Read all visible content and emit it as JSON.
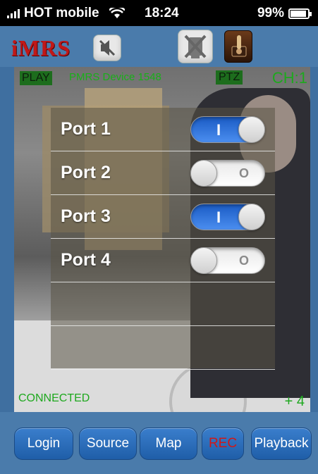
{
  "status_bar": {
    "carrier": "HOT mobile",
    "time": "18:24",
    "battery": "99%"
  },
  "header": {
    "logo": "iMRS",
    "mute_icon": "speaker-muted-icon",
    "camera_icon": "camera-off-icon",
    "switch_icon": "toggle-switch-icon"
  },
  "video": {
    "play_label": "PLAY",
    "device_label": "PMRS Device 1548",
    "ptz_label": "PTZ",
    "channel_label": "CH:1",
    "connection_status": "CONNECTED",
    "zoom_label": "+ 4"
  },
  "ports": [
    {
      "label": "Port 1",
      "state": "on",
      "mark": "I"
    },
    {
      "label": "Port 2",
      "state": "off",
      "mark": "O"
    },
    {
      "label": "Port 3",
      "state": "on",
      "mark": "I"
    },
    {
      "label": "Port 4",
      "state": "off",
      "mark": "O"
    }
  ],
  "toolbar": {
    "login": "Login",
    "source": "Source",
    "map": "Map",
    "rec": "REC",
    "playback": "Playback"
  },
  "colors": {
    "background": "#4a7bab",
    "overlay_green": "#1ea81e",
    "rec_red": "#d01818",
    "toggle_on": "#1a5bc4"
  }
}
